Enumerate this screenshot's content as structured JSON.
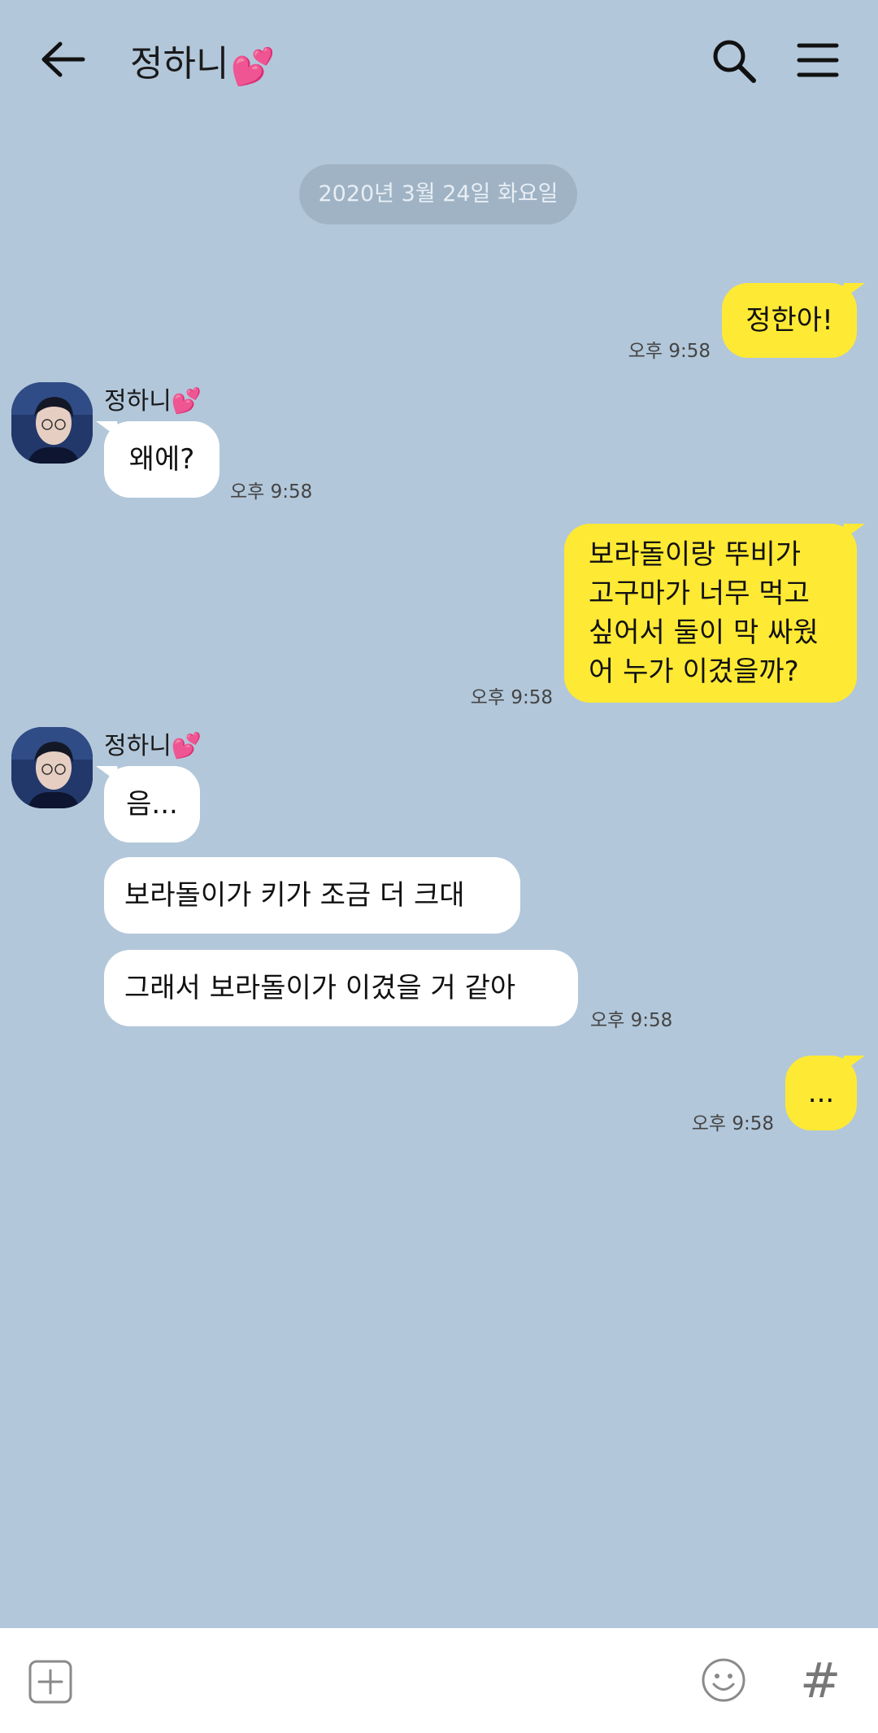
{
  "header": {
    "title": "정하니",
    "title_emoji": "💕"
  },
  "date_divider": "2020년 3월 24일 화요일",
  "messages": [
    {
      "side": "me",
      "text": "정한아!",
      "time": "오후 9:58"
    },
    {
      "side": "them",
      "sender": "정하니",
      "lines": [
        "왜에?"
      ],
      "time": "오후 9:58"
    },
    {
      "side": "me",
      "lines": [
        "보라돌이랑 뚜비가",
        "고구마가 너무 먹고",
        "싶어서 둘이 막 싸웠",
        "어 누가 이겼을까?"
      ],
      "time": "오후 9:58"
    },
    {
      "side": "them",
      "sender": "정하니",
      "text": "음...",
      "time": ""
    },
    {
      "side": "them",
      "text": "보라돌이가 키가 조금 더 크대",
      "time": ""
    },
    {
      "side": "them",
      "text": "그래서 보라돌이가 이겼을 거 같아",
      "time": "오후 9:58"
    },
    {
      "side": "me",
      "text": "...",
      "time": "오후 9:58"
    }
  ],
  "composer": {
    "hash_symbol": "#"
  },
  "colors": {
    "background": "#b2c7da",
    "my_bubble": "#fee934",
    "their_bubble": "#ffffff"
  },
  "icons": [
    "back-arrow-icon",
    "search-icon",
    "menu-icon",
    "plus-icon",
    "emoji-icon",
    "hash-icon"
  ]
}
